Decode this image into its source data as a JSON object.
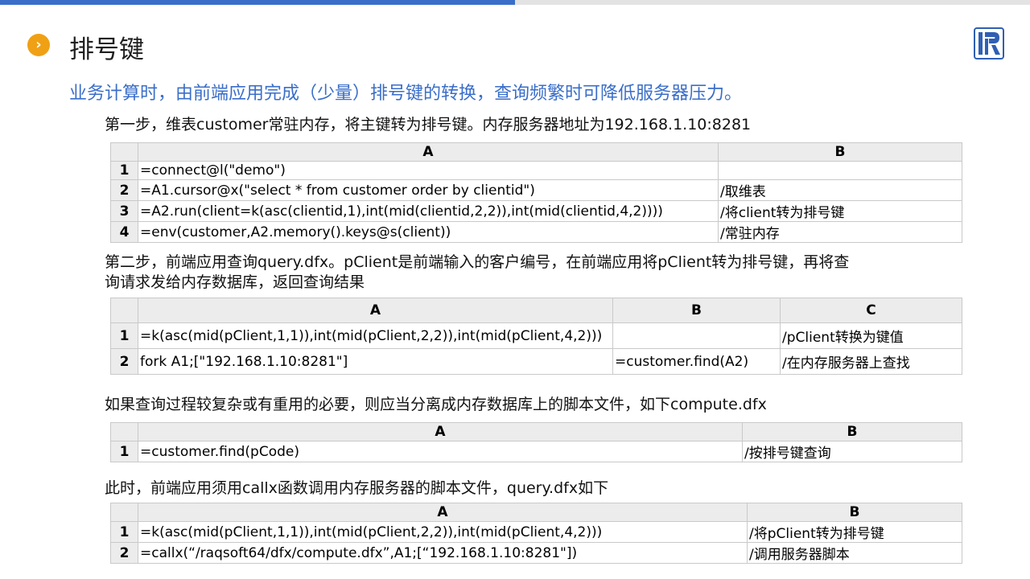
{
  "slide": {
    "title": "排号键",
    "subtitle": "业务计算时，由前端应用完成（少量）排号键的转换，查询频繁时可降低服务器压力。",
    "bullet_icon": "chevron-right-icon",
    "logo_icon": "raqsoft-logo-icon",
    "accent_color": "#3a6ec9",
    "bullet_color": "#f0a014"
  },
  "step1": {
    "text": "第一步，维表customer常驻内存，将主键转为排号键。内存服务器地址为192.168.1.10:8281",
    "columns": [
      "A",
      "B"
    ],
    "rows": [
      {
        "num": "1",
        "cells": [
          "=connect@l(\"demo\")",
          ""
        ]
      },
      {
        "num": "2",
        "cells": [
          "=A1.cursor@x(\"select * from customer order by clientid\")",
          "/取维表"
        ]
      },
      {
        "num": "3",
        "cells": [
          "=A2.run(client=k(asc(clientid,1),int(mid(clientid,2,2)),int(mid(clientid,4,2))))",
          "/将client转为排号键"
        ]
      },
      {
        "num": "4",
        "cells": [
          "=env(customer,A2.memory().keys@s(client))",
          "/常驻内存"
        ]
      }
    ]
  },
  "step2": {
    "text_line1": "第二步，前端应用查询query.dfx。pClient是前端输入的客户编号，在前端应用将pClient转为排号键，再将查",
    "text_line2": "询请求发给内存数据库，返回查询结果",
    "columns": [
      "A",
      "B",
      "C"
    ],
    "rows": [
      {
        "num": "1",
        "cells": [
          "=k(asc(mid(pClient,1,1)),int(mid(pClient,2,2)),int(mid(pClient,4,2)))",
          "",
          "/pClient转换为键值"
        ]
      },
      {
        "num": "2",
        "cells": [
          "fork A1;[\"192.168.1.10:8281\"]",
          "=customer.find(A2)",
          "/在内存服务器上查找"
        ]
      }
    ]
  },
  "step3": {
    "text": "如果查询过程较复杂或有重用的必要，则应当分离成内存数据库上的脚本文件，如下compute.dfx",
    "columns": [
      "A",
      "B"
    ],
    "rows": [
      {
        "num": "1",
        "cells": [
          "=customer.find(pCode)",
          "/按排号键查询"
        ]
      }
    ]
  },
  "step4": {
    "text": "此时，前端应用须用callx函数调用内存服务器的脚本文件，query.dfx如下",
    "columns": [
      "A",
      "B"
    ],
    "rows": [
      {
        "num": "1",
        "cells": [
          "=k(asc(mid(pClient,1,1)),int(mid(pClient,2,2)),int(mid(pClient,4,2)))",
          "/将pClient转为排号键"
        ]
      },
      {
        "num": "2",
        "cells": [
          "=callx(“/raqsoft64/dfx/compute.dfx”,A1;[“192.168.1.10:8281\"])",
          "/调用服务器脚本"
        ]
      }
    ]
  }
}
